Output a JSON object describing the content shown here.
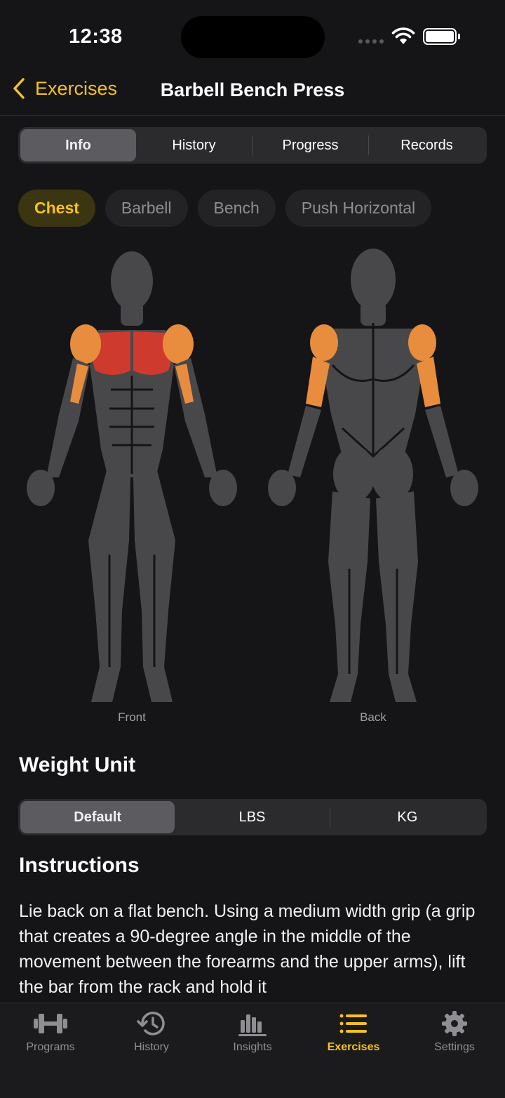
{
  "status": {
    "time": "12:38"
  },
  "nav": {
    "back_label": "Exercises",
    "title": "Barbell Bench Press"
  },
  "tabs": [
    {
      "label": "Info",
      "selected": true
    },
    {
      "label": "History",
      "selected": false
    },
    {
      "label": "Progress",
      "selected": false
    },
    {
      "label": "Records",
      "selected": false
    }
  ],
  "chips": [
    {
      "label": "Chest",
      "active": true
    },
    {
      "label": "Barbell",
      "active": false
    },
    {
      "label": "Bench",
      "active": false
    },
    {
      "label": "Push Horizontal",
      "active": false
    }
  ],
  "body_map": {
    "front_label": "Front",
    "back_label": "Back",
    "primary_color": "#cf3a2f",
    "secondary_color": "#e88d3d",
    "muscle_color": "#48484b"
  },
  "weight_unit": {
    "heading": "Weight Unit",
    "options": [
      {
        "label": "Default",
        "selected": true
      },
      {
        "label": "LBS",
        "selected": false
      },
      {
        "label": "KG",
        "selected": false
      }
    ]
  },
  "instructions": {
    "heading": "Instructions",
    "text": "Lie back on a flat bench. Using a medium width grip (a grip that creates a 90-degree angle in the middle of the movement between the forearms and the upper arms), lift the bar from the rack and hold it"
  },
  "tabbar": [
    {
      "label": "Programs",
      "icon": "dumbbell-icon",
      "active": false
    },
    {
      "label": "History",
      "icon": "history-clock-icon",
      "active": false
    },
    {
      "label": "Insights",
      "icon": "bar-chart-icon",
      "active": false
    },
    {
      "label": "Exercises",
      "icon": "list-icon",
      "active": true
    },
    {
      "label": "Settings",
      "icon": "gear-icon",
      "active": false
    }
  ],
  "colors": {
    "accent": "#f7c21b",
    "background": "#151517"
  }
}
